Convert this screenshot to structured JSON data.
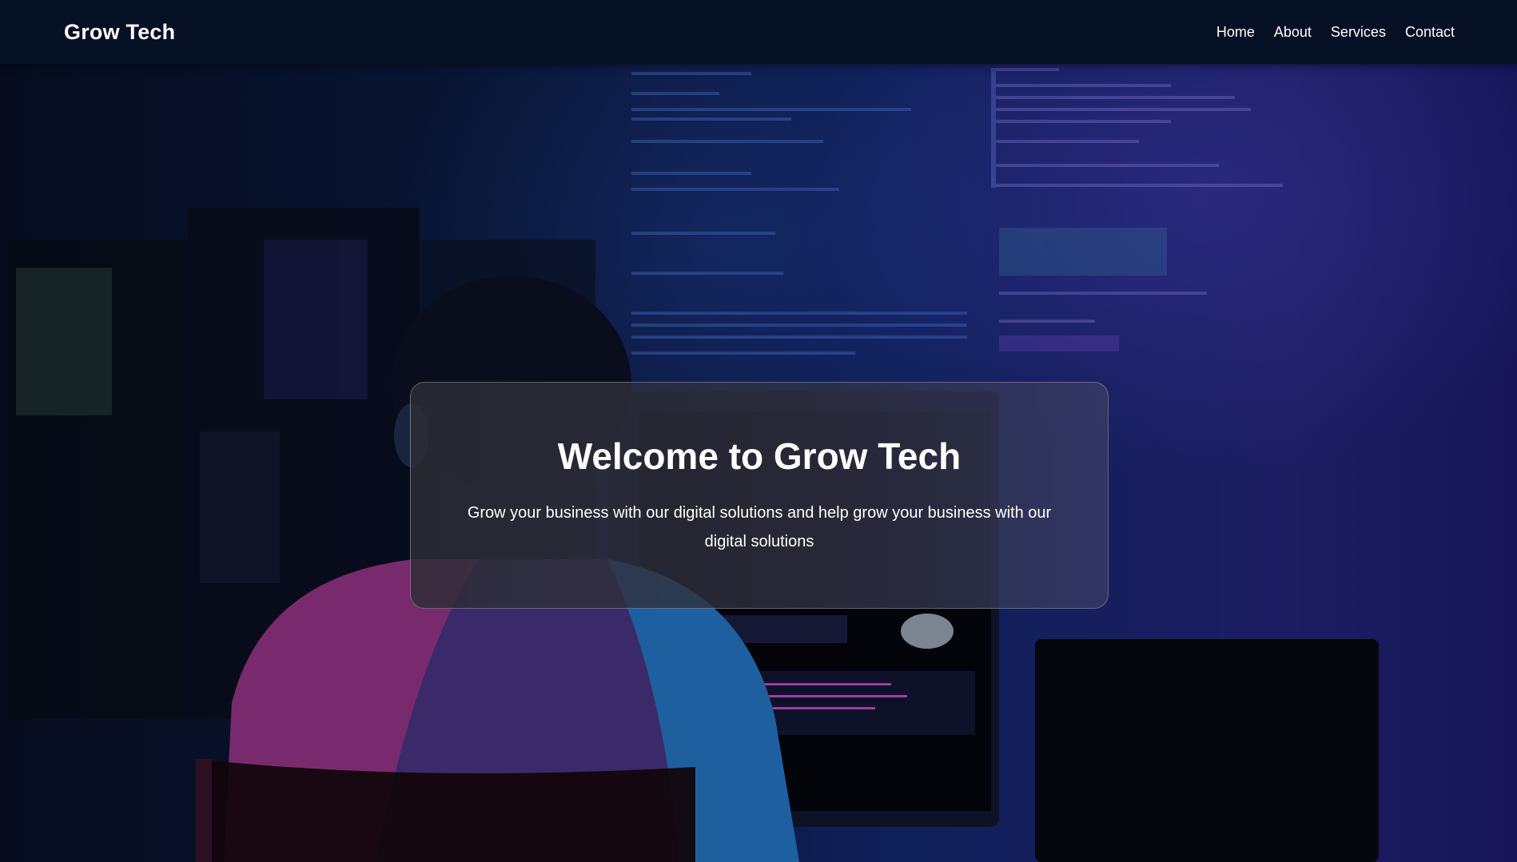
{
  "navbar": {
    "brand": "Grow Tech",
    "links": [
      {
        "label": "Home"
      },
      {
        "label": "About"
      },
      {
        "label": "Services"
      },
      {
        "label": "Contact"
      }
    ]
  },
  "hero": {
    "title": "Welcome to Grow Tech",
    "subtitle": "Grow your business with our digital solutions and help grow your business with our digital solutions",
    "background_image": "developer-coding-at-night-photo"
  },
  "colors": {
    "navbar_bg": "#061024",
    "background": "#07102a",
    "text": "#ffffff"
  }
}
